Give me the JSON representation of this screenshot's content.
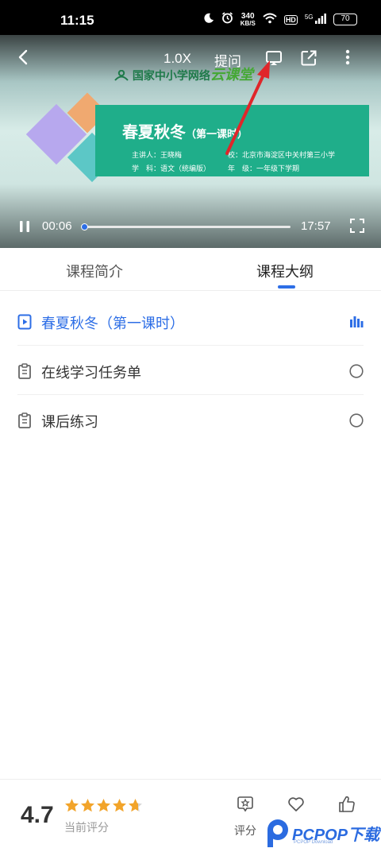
{
  "status_bar": {
    "time": "11:15",
    "net_speed_value": "340",
    "net_speed_unit": "KB/S",
    "hd_badge": "HD",
    "signal_label": "5G",
    "battery": "70",
    "icons": [
      "moon-icon",
      "alarm-icon",
      "wifi-icon",
      "hd-icon",
      "signal-icon",
      "battery-icon"
    ]
  },
  "player": {
    "speed_label": "1.0X",
    "ask_label": "提问",
    "current_time": "00:06",
    "total_time": "17:57",
    "progress_fraction": 0.006,
    "slide": {
      "logo_text": "国家中小学网络",
      "logo_brand": "云课堂",
      "title": "春夏秋冬",
      "title_suffix": "（第一课时）",
      "lecturer": "主讲人：王晓梅",
      "school": "校：北京市海淀区中关村第三小学",
      "subject": "学　科：语文（统编版）",
      "grade": "年　级：一年级下学期"
    }
  },
  "tabs": [
    {
      "label": "课程简介",
      "active": false
    },
    {
      "label": "课程大纲",
      "active": true
    }
  ],
  "outline": [
    {
      "label": "春夏秋冬（第一课时）",
      "icon": "video-play-icon",
      "status": "playing-bars-icon",
      "current": true
    },
    {
      "label": "在线学习任务单",
      "icon": "clipboard-icon",
      "status": "empty-circle-icon",
      "current": false
    },
    {
      "label": "课后练习",
      "icon": "clipboard-icon",
      "status": "empty-circle-icon",
      "current": false
    }
  ],
  "rating": {
    "score": "4.7",
    "stars_value": 4.7,
    "stars_max": 5,
    "caption": "当前评分"
  },
  "actions": [
    {
      "label": "评分",
      "icon": "rate-star-icon"
    },
    {
      "label": "",
      "icon": "heart-icon"
    },
    {
      "label": "",
      "icon": "thumbs-up-icon"
    }
  ],
  "watermark": {
    "brand": "PCPOP",
    "brand_cn": "下载",
    "small": "PCPOP Download"
  },
  "colors": {
    "accent": "#2d6ee6",
    "star": "#f2a42a",
    "banner": "#1fae8a",
    "annotation_arrow": "#e0262a"
  }
}
